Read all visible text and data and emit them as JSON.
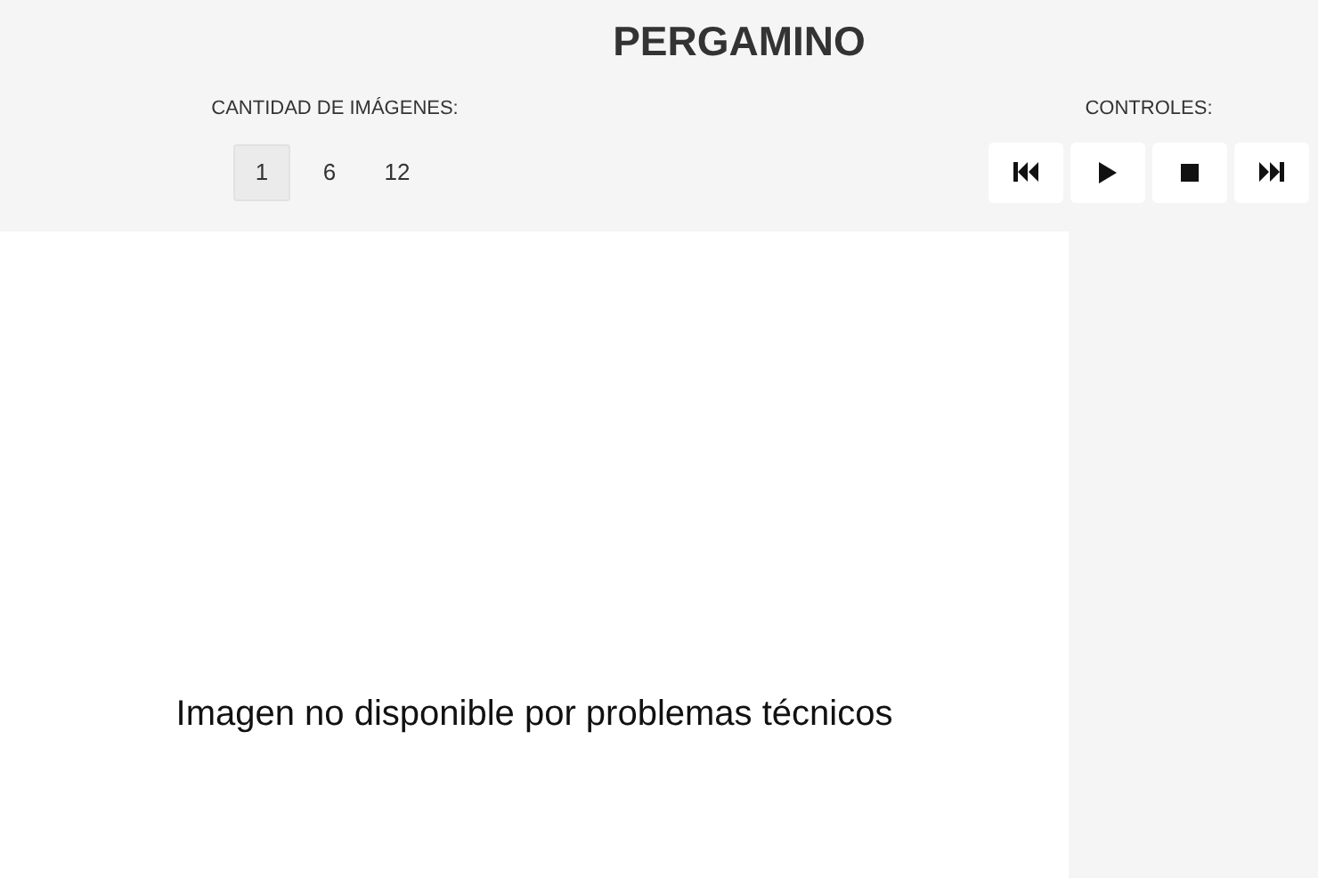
{
  "title": "PERGAMINO",
  "image_count": {
    "label": "CANTIDAD DE IMÁGENES:",
    "options": [
      {
        "label": "1",
        "selected": true
      },
      {
        "label": "6",
        "selected": false
      },
      {
        "label": "12",
        "selected": false
      }
    ]
  },
  "controls": {
    "label": "CONTROLES:",
    "buttons": [
      {
        "kind": "first"
      },
      {
        "kind": "play"
      },
      {
        "kind": "stop"
      },
      {
        "kind": "last"
      }
    ]
  },
  "viewer": {
    "message": "Imagen no disponible por problemas técnicos"
  }
}
